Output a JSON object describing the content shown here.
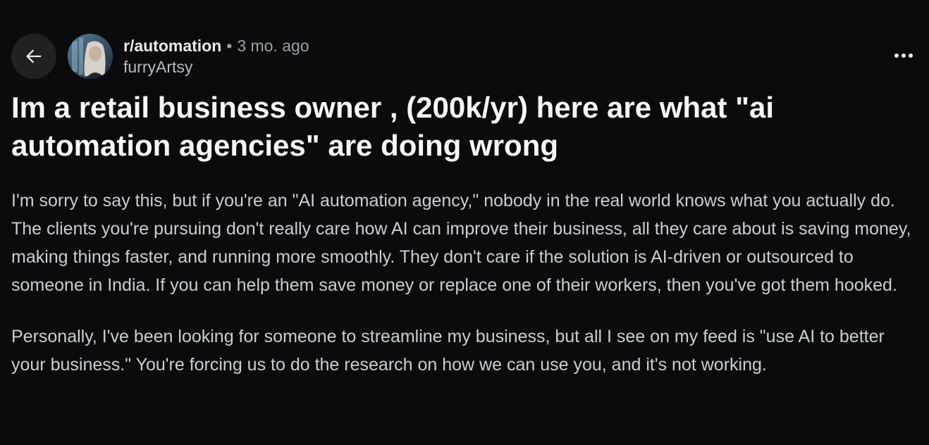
{
  "post": {
    "subreddit": "r/automation",
    "separator": "•",
    "age": "3 mo. ago",
    "author": "furryArtsy",
    "title": "Im a retail business owner , (200k/yr) here are what \"ai automation agencies\" are doing wrong",
    "paragraphs": [
      "I'm sorry to say this, but if you're an \"AI automation agency,\" nobody in the real world knows what you actually do. The clients you're pursuing don't really care how AI can improve their business, all they care about is saving money, making things faster, and running more smoothly. They don't care if the solution is AI-driven or outsourced to someone in India. If you can help them save money or replace one of their workers, then you've got them hooked.",
      "Personally, I've been looking for someone to streamline my business, but all I see on my feed is \"use AI to better your business.\" You're forcing us to do the research on how we can use you, and it's not working."
    ]
  },
  "icons": {
    "back": "arrow-left-icon",
    "more": "more-horizontal-icon",
    "avatar": "user-avatar"
  },
  "colors": {
    "background": "#0b0b0d",
    "button_bg": "#1f2123",
    "title_text": "#f4f6f7",
    "body_text": "#c9ced2",
    "muted_text": "#9aa1a6"
  }
}
